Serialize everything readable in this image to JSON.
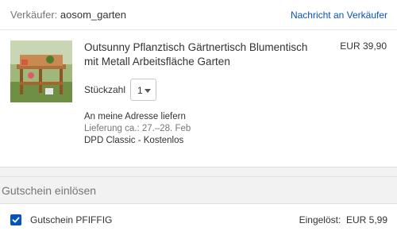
{
  "seller": {
    "label": "Verkäufer:",
    "name": "aosom_garten",
    "contact_link": "Nachricht an Verkäufer"
  },
  "item": {
    "title": "Outsunny Pflanztisch Gärtnertisch Blumentisch mit Metall Arbeitsfläche Garten",
    "price": "EUR 39,90",
    "quantity_label": "Stückzahl",
    "quantity_value": "1"
  },
  "shipping": {
    "address": "An meine Adresse liefern",
    "delivery_estimate": "Lieferung ca.: 27.–28. Feb",
    "method": "DPD Classic - Kostenlos"
  },
  "coupon": {
    "section_title": "Gutschein einlösen",
    "label": "Gutschein PFIFFIG",
    "checked": true,
    "redeemed_label": "Eingelöst:",
    "redeemed_amount": "EUR 5,99"
  },
  "colors": {
    "link": "#0654ba",
    "checkbox": "#0654ba"
  },
  "icons": {
    "quantity_caret": "chevron-down-icon",
    "checkbox_check": "check-icon"
  }
}
